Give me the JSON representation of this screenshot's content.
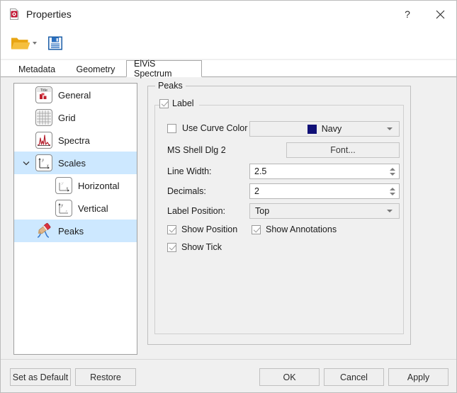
{
  "window": {
    "title": "Properties",
    "icon": "properties-document-icon",
    "help_label": "?",
    "close_label": "✕"
  },
  "toolbar": {
    "open_label": "open-folder",
    "open_dropdown_label": "open-folder-dropdown",
    "save_label": "save-floppy"
  },
  "tabs": [
    {
      "label": "Metadata",
      "selected": false
    },
    {
      "label": "Geometry",
      "selected": false
    },
    {
      "label": "ElViS Spectrum",
      "selected": true
    }
  ],
  "tree": {
    "items": [
      {
        "label": "General",
        "icon": "title-chart-icon",
        "selected": false,
        "indent": 0,
        "expander": ""
      },
      {
        "label": "Grid",
        "icon": "grid-icon",
        "selected": false,
        "indent": 0,
        "expander": ""
      },
      {
        "label": "Spectra",
        "icon": "spectra-peaks-icon",
        "selected": false,
        "indent": 0,
        "expander": ""
      },
      {
        "label": "Scales",
        "icon": "axes-xy-icon",
        "selected": true,
        "indent": 0,
        "expander": "chevron-down"
      },
      {
        "label": "Horizontal",
        "icon": "axis-x-icon",
        "selected": false,
        "indent": 1,
        "expander": ""
      },
      {
        "label": "Vertical",
        "icon": "axis-y-icon",
        "selected": false,
        "indent": 1,
        "expander": ""
      },
      {
        "label": "Peaks",
        "icon": "peak-marker-icon",
        "selected": true,
        "indent": 0,
        "expander": ""
      }
    ]
  },
  "peaks": {
    "group_title": "Peaks",
    "label_group_title": "Label",
    "label_checked": true,
    "use_curve_color": {
      "label": "Use Curve Color",
      "checked": false
    },
    "color": {
      "value": "Navy",
      "hex": "#101077"
    },
    "font": {
      "current": "MS Shell Dlg 2",
      "button_label": "Font..."
    },
    "line_width": {
      "label": "Line Width:",
      "value": "2.5"
    },
    "decimals": {
      "label": "Decimals:",
      "value": "2"
    },
    "label_position": {
      "label": "Label Position:",
      "value": "Top"
    },
    "show_position": {
      "label": "Show Position",
      "checked": true
    },
    "show_annotations": {
      "label": "Show Annotations",
      "checked": true
    },
    "show_tick": {
      "label": "Show Tick",
      "checked": true
    }
  },
  "footer": {
    "set_as_default": "Set as Default",
    "restore": "Restore",
    "ok": "OK",
    "cancel": "Cancel",
    "apply": "Apply"
  }
}
